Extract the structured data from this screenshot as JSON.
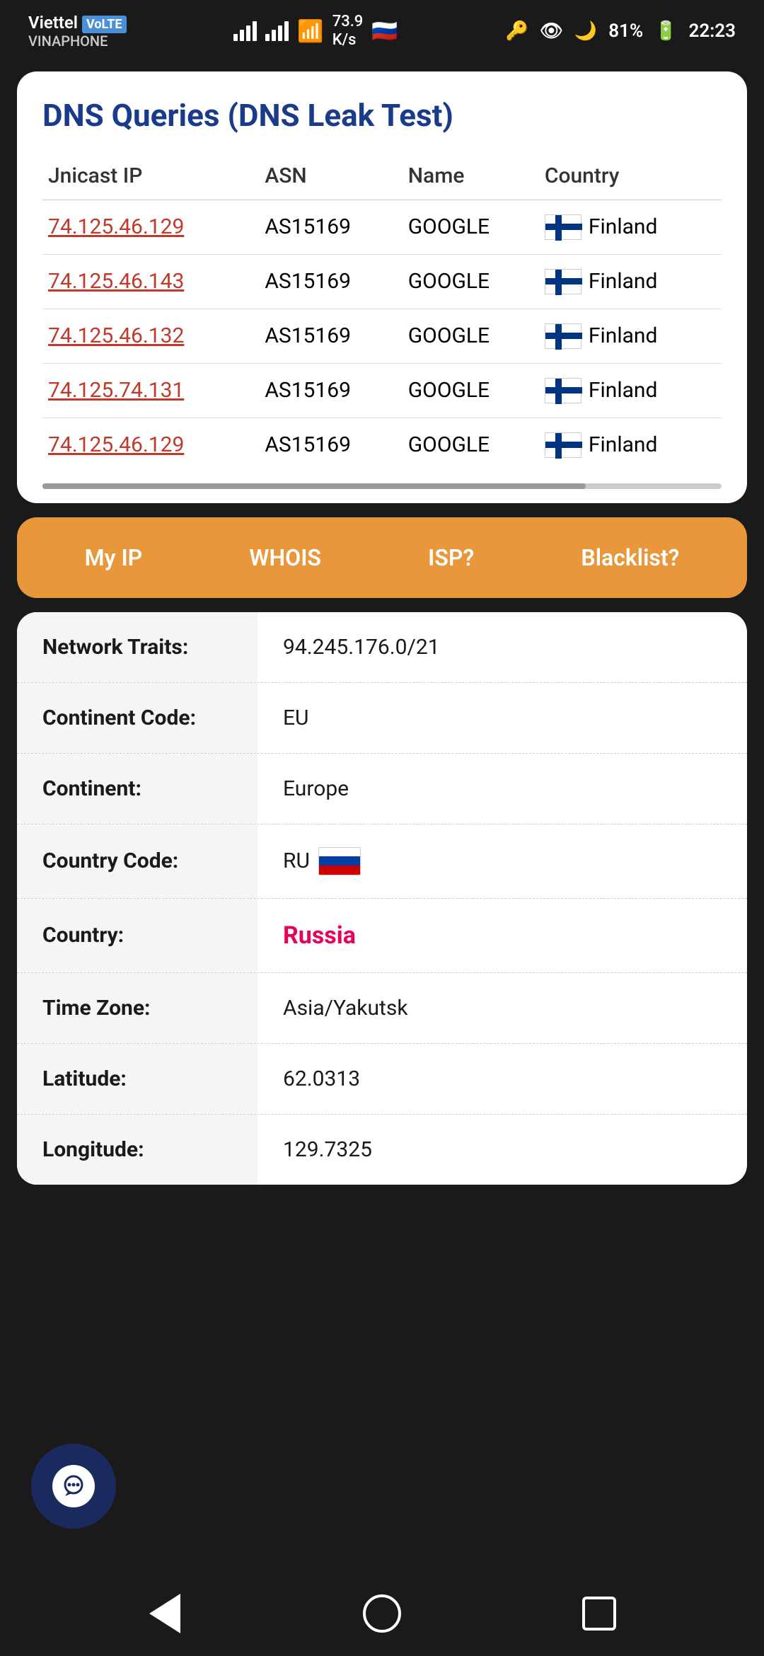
{
  "statusBar": {
    "carrier": "Viettel",
    "carrierSub": "VINAPHONE",
    "speed": "73.9",
    "speedUnit": "K/s",
    "batteryPercent": "81%",
    "time": "22:23"
  },
  "dnsCard": {
    "title": "DNS Queries (DNS Leak Test)",
    "columns": [
      "Jnicast IP",
      "ASN",
      "Name",
      "Country"
    ],
    "rows": [
      {
        "ip": "74.125.46.129",
        "asn": "AS15169",
        "name": "GOOGLE",
        "country": "Finland"
      },
      {
        "ip": "74.125.46.143",
        "asn": "AS15169",
        "name": "GOOGLE",
        "country": "Finland"
      },
      {
        "ip": "74.125.46.132",
        "asn": "AS15169",
        "name": "GOOGLE",
        "country": "Finland"
      },
      {
        "ip": "74.125.74.131",
        "asn": "AS15169",
        "name": "GOOGLE",
        "country": "Finland"
      },
      {
        "ip": "74.125.46.129",
        "asn": "AS15169",
        "name": "GOOGLE",
        "country": "Finland"
      }
    ]
  },
  "navTabs": {
    "tabs": [
      "My IP",
      "WHOIS",
      "ISP?",
      "Blacklist?"
    ]
  },
  "infoTable": {
    "rows": [
      {
        "label": "Network Traits:",
        "value": "94.245.176.0/21",
        "type": "normal"
      },
      {
        "label": "Continent Code:",
        "value": "EU",
        "type": "normal"
      },
      {
        "label": "Continent:",
        "value": "Europe",
        "type": "normal"
      },
      {
        "label": "Country Code:",
        "value": "RU",
        "type": "flag-ru"
      },
      {
        "label": "Country:",
        "value": "Russia",
        "type": "red"
      },
      {
        "label": "Time Zone:",
        "value": "Asia/Yakutsk",
        "type": "normal"
      },
      {
        "label": "Latitude:",
        "value": "62.0313",
        "type": "normal"
      },
      {
        "label": "Longitude:",
        "value": "129.7325",
        "type": "normal"
      }
    ]
  },
  "bottomNav": {
    "back": "back",
    "home": "home",
    "recents": "recents"
  }
}
